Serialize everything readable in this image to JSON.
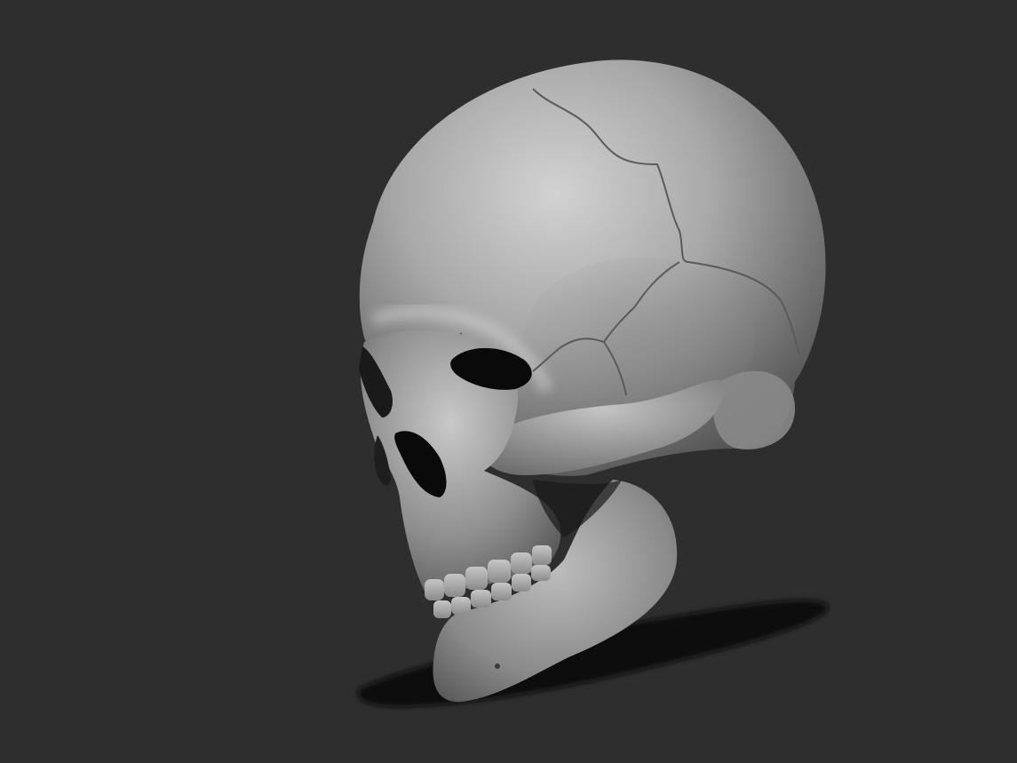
{
  "scene": {
    "subject": "skull-sculpt",
    "colors": {
      "background": "#2e2e2e",
      "bone_light": "#d4d4d4",
      "bone_mid": "#9a9a9a",
      "bone_dark": "#4a4a4a",
      "shadow": "#0d0d0d",
      "cavity": "#0a0a0a"
    }
  }
}
